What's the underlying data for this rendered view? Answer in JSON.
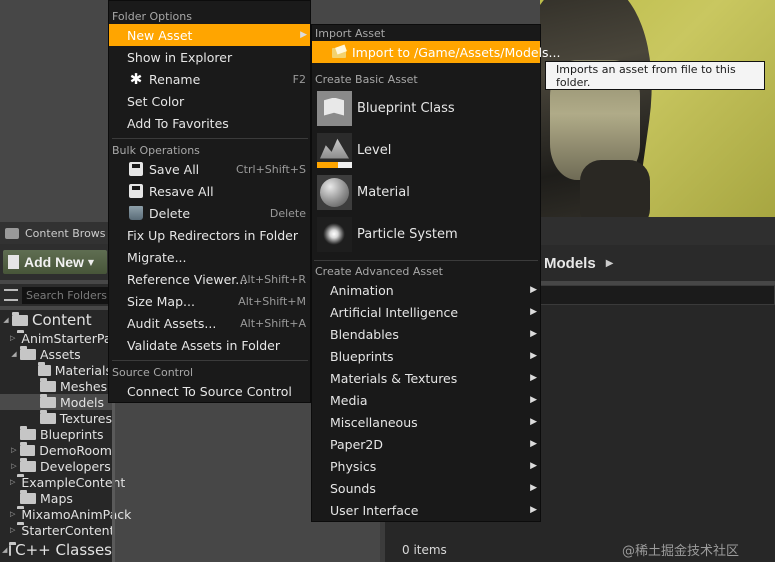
{
  "content_browser": {
    "tab_label": "Content Brows",
    "add_new_label": "Add New",
    "search_placeholder": "Search Folders",
    "breadcrumb": "Models",
    "items_count": "0 items",
    "tree": [
      {
        "label": "Content",
        "level": 0,
        "big": true,
        "expanded": true,
        "selected": false
      },
      {
        "label": "AnimStarterPack",
        "level": 1,
        "expanded": false
      },
      {
        "label": "Assets",
        "level": 1,
        "expanded": true
      },
      {
        "label": "Materials",
        "level": 2
      },
      {
        "label": "Meshes",
        "level": 2
      },
      {
        "label": "Models",
        "level": 2,
        "selected": true
      },
      {
        "label": "Textures",
        "level": 2
      },
      {
        "label": "Blueprints",
        "level": 1
      },
      {
        "label": "DemoRoom",
        "level": 1,
        "expanded": false
      },
      {
        "label": "Developers",
        "level": 1,
        "expanded": false
      },
      {
        "label": "ExampleContent",
        "level": 1,
        "expanded": false
      },
      {
        "label": "Maps",
        "level": 1
      },
      {
        "label": "MixamoAnimPack",
        "level": 1,
        "expanded": false
      },
      {
        "label": "StarterContent",
        "level": 1,
        "expanded": false
      },
      {
        "label": "C++ Classes",
        "level": 0,
        "big": true,
        "expanded": true
      }
    ]
  },
  "menu_folder": {
    "section_folder_options": "Folder Options",
    "new_asset": "New Asset",
    "show_in_explorer": "Show in Explorer",
    "rename": "Rename",
    "rename_shortcut": "F2",
    "set_color": "Set Color",
    "add_to_favorites": "Add To Favorites",
    "section_bulk": "Bulk Operations",
    "save_all": "Save All",
    "save_all_shortcut": "Ctrl+Shift+S",
    "resave_all": "Resave All",
    "delete": "Delete",
    "delete_shortcut": "Delete",
    "fix_up_redirectors": "Fix Up Redirectors in Folder",
    "migrate": "Migrate...",
    "reference_viewer": "Reference Viewer...",
    "reference_viewer_shortcut": "Alt+Shift+R",
    "size_map": "Size Map...",
    "size_map_shortcut": "Alt+Shift+M",
    "audit_assets": "Audit Assets...",
    "audit_assets_shortcut": "Alt+Shift+A",
    "validate_assets": "Validate Assets in Folder",
    "section_source_control": "Source Control",
    "connect_source_control": "Connect To Source Control"
  },
  "menu_new_asset": {
    "section_import": "Import Asset",
    "import_to": "Import to /Game/Assets/Models...",
    "section_basic": "Create Basic Asset",
    "basic": [
      {
        "label": "Blueprint Class",
        "icon": "blueprint-class-icon"
      },
      {
        "label": "Level",
        "icon": "level-icon"
      },
      {
        "label": "Material",
        "icon": "material-icon"
      },
      {
        "label": "Particle System",
        "icon": "particle-system-icon"
      }
    ],
    "section_advanced": "Create Advanced Asset",
    "advanced": [
      "Animation",
      "Artificial Intelligence",
      "Blendables",
      "Blueprints",
      "Materials & Textures",
      "Media",
      "Miscellaneous",
      "Paper2D",
      "Physics",
      "Sounds",
      "User Interface"
    ]
  },
  "tooltip": "Imports an asset from file to this folder.",
  "watermark": "@稀土掘金技术社区",
  "colors": {
    "highlight": "#ffa500",
    "menu_bg": "#1a1a1a",
    "add_new_green": "#52613f"
  }
}
